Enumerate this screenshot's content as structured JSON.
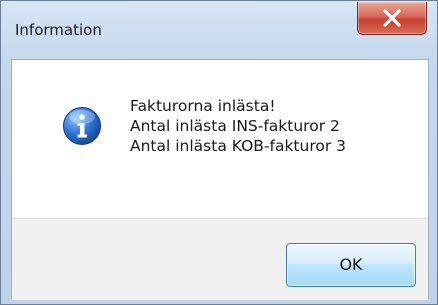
{
  "window": {
    "title": "Information"
  },
  "dialog": {
    "icon": "info-icon",
    "message_lines": [
      "Fakturorna inlästa!",
      "Antal inlästa INS-fakturor 2",
      "Antal inlästa KOB-fakturor 3"
    ]
  },
  "buttons": {
    "ok_label": "OK",
    "close_icon": "close-icon"
  },
  "colors": {
    "close_red": "#c6402d",
    "ok_border": "#3c7fb1",
    "info_blue": "#2a6fd1"
  }
}
